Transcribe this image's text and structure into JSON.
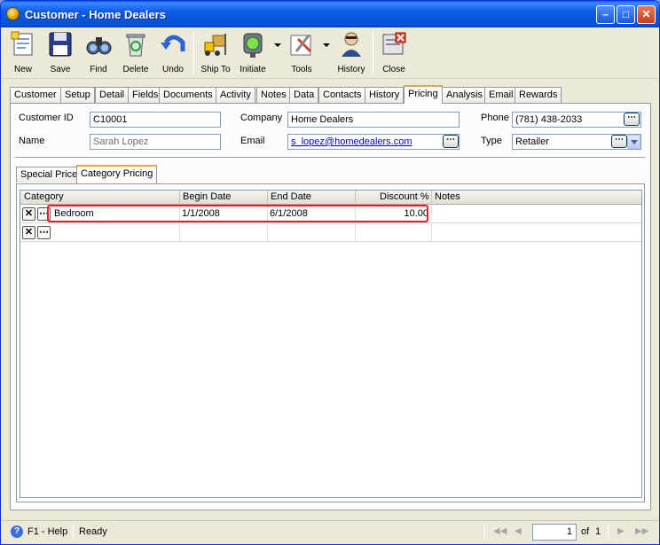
{
  "window": {
    "title": "Customer - Home Dealers"
  },
  "toolbar": {
    "new": "New",
    "save": "Save",
    "find": "Find",
    "delete": "Delete",
    "undo": "Undo",
    "ship_to": "Ship To",
    "initiate": "Initiate",
    "tools": "Tools",
    "history": "History",
    "close": "Close"
  },
  "tabs": [
    "Customer",
    "Setup",
    "Detail",
    "Fields",
    "Documents",
    "Activity",
    "Notes",
    "Data",
    "Contacts",
    "History",
    "Pricing",
    "Analysis",
    "Email",
    "Rewards"
  ],
  "active_tab": "Pricing",
  "form": {
    "customer_id_label": "Customer ID",
    "customer_id": "C10001",
    "name_label": "Name",
    "name": "Sarah Lopez",
    "company_label": "Company",
    "company": "Home Dealers",
    "email_label": "Email",
    "email": "s_lopez@homedealers.com",
    "phone_label": "Phone",
    "phone": "(781) 438-2033",
    "type_label": "Type",
    "type": "Retailer",
    "ellipsis": "⋯"
  },
  "subtabs": [
    "Special Price",
    "Category Pricing"
  ],
  "grid": {
    "columns": [
      "Category",
      "Begin Date",
      "End Date",
      "Discount %",
      "Notes"
    ],
    "rows": [
      {
        "category": "Bedroom",
        "begin": "1/1/2008",
        "end": "6/1/2008",
        "discount": "10.00",
        "notes": ""
      }
    ],
    "row_buttons": {
      "remove": "✕",
      "more": "⋯"
    }
  },
  "status": {
    "help": "F1 - Help",
    "state": "Ready",
    "page": "1",
    "of_label": "of",
    "total": "1"
  },
  "colors": {
    "title_blue": "#0651d8",
    "tab_accent": "#f1a33a",
    "highlight_red": "#e0202e",
    "link": "#0000cc"
  }
}
